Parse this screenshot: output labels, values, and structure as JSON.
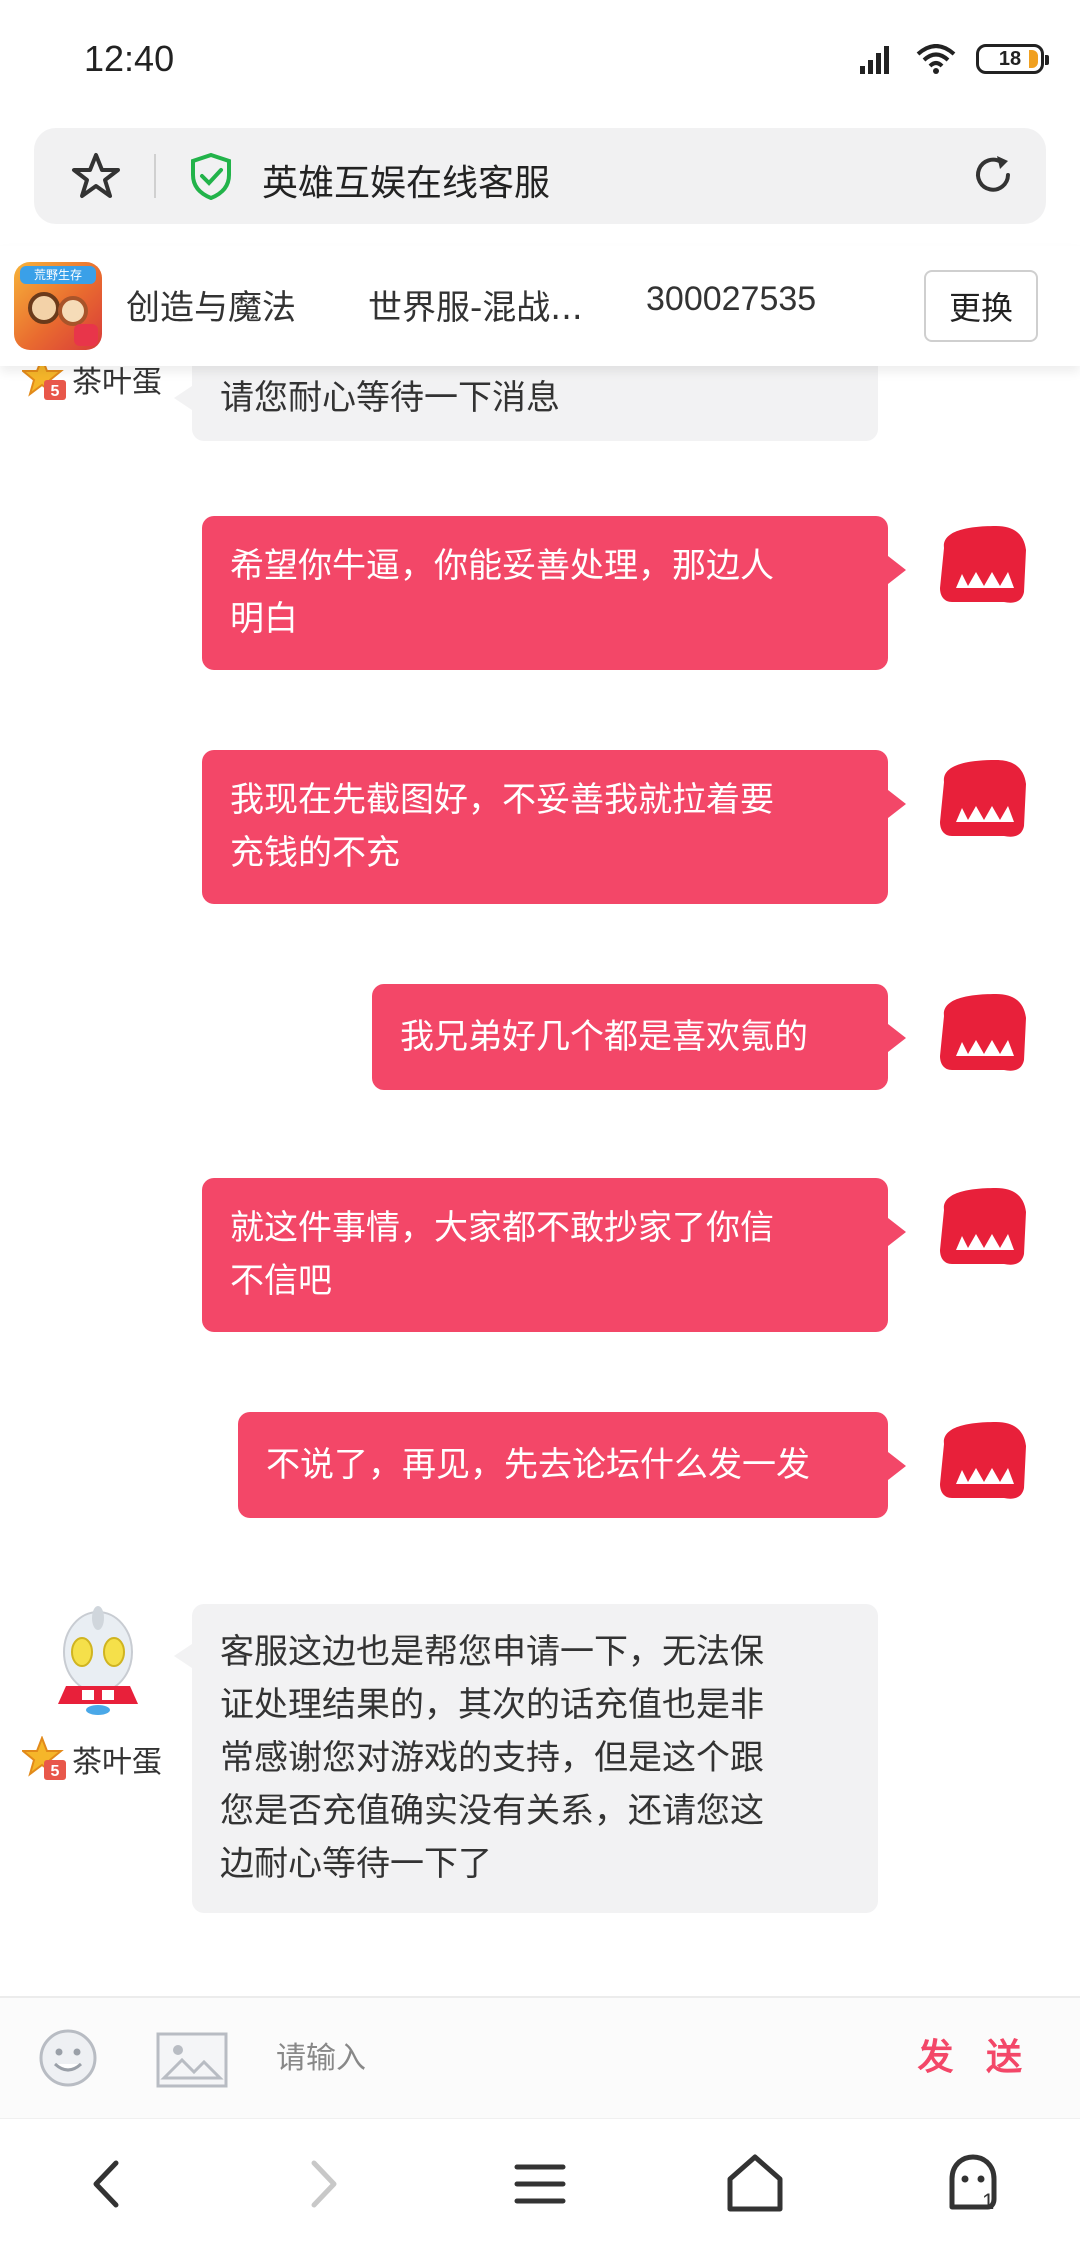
{
  "status_bar": {
    "time": "12:40",
    "battery": "18"
  },
  "address_bar": {
    "title": "英雄互娱在线客服"
  },
  "game_header": {
    "icon_caption": "荒野生存",
    "game_name": "创造与魔法",
    "server": "世界服-混战...",
    "account_id": "300027535",
    "change_label": "更换"
  },
  "messages": [
    {
      "from": "agent",
      "name": "茶叶蛋",
      "lines": [
        "请您耐心等待一下消息"
      ]
    },
    {
      "from": "user",
      "lines": [
        "希望你牛逼，你能妥善处理，那边人",
        "明白"
      ]
    },
    {
      "from": "user",
      "lines": [
        "我现在先截图好，不妥善我就拉着要",
        "充钱的不充"
      ]
    },
    {
      "from": "user",
      "lines": [
        "我兄弟好几个都是喜欢氪的"
      ]
    },
    {
      "from": "user",
      "lines": [
        "就这件事情，大家都不敢抄家了你信",
        "不信吧"
      ]
    },
    {
      "from": "user",
      "lines": [
        "不说了，再见，先去论坛什么发一发"
      ]
    },
    {
      "from": "agent",
      "name": "茶叶蛋",
      "lines": [
        "客服这边也是帮您申请一下，无法保",
        "证处理结果的，其次的话充值也是非",
        "常感谢您对游戏的支持，但是这个跟",
        "您是否充值确实没有关系，还请您这",
        "边耐心等待一下了"
      ]
    }
  ],
  "input_bar": {
    "placeholder": "请输入",
    "send_label": "发 送"
  },
  "bottom_nav": {
    "tabs_count": "1"
  },
  "colors": {
    "accent": "#f34768",
    "agent_bubble": "#f2f2f3",
    "shield": "#22b34a"
  }
}
